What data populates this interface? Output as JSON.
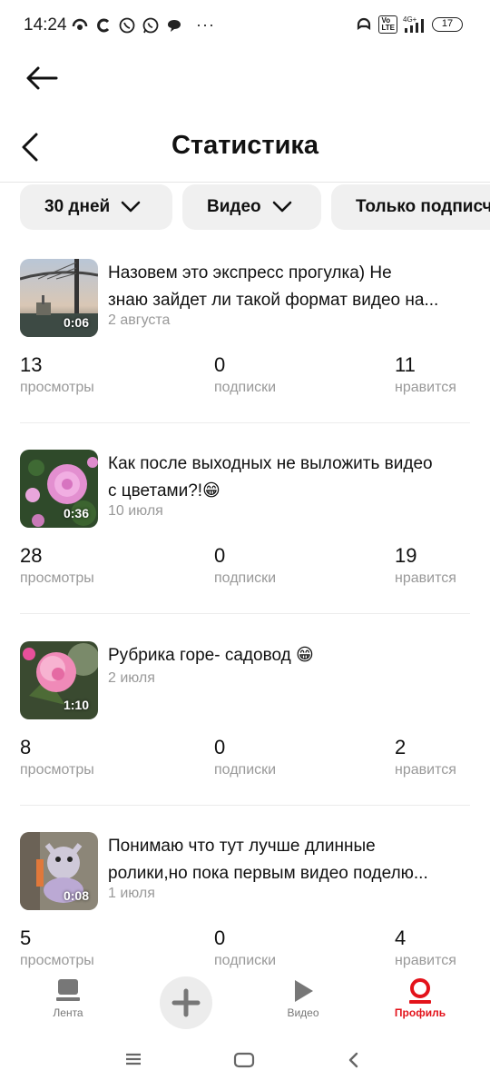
{
  "status_bar": {
    "time": "14:24",
    "dots": "···",
    "network": "4G+",
    "volte": "Vo LTE",
    "battery": "17"
  },
  "header": {
    "title": "Статистика"
  },
  "filters": [
    {
      "label": "30 дней"
    },
    {
      "label": "Видео"
    },
    {
      "label": "Только подписчики"
    }
  ],
  "stat_labels": {
    "views": "просмотры",
    "subs": "подписки",
    "likes": "нравится"
  },
  "videos": [
    {
      "title_line1": "Назовем это экспресс прогулка) Не",
      "title_line2": "знаю зайдет ли такой формат видео на...",
      "date": "2 августа",
      "duration": "0:06",
      "views": "13",
      "subs": "0",
      "likes": "11"
    },
    {
      "title_line1": "Как после выходных не выложить видео",
      "title_line2": "с цветами?!😁",
      "date": "10 июля",
      "duration": "0:36",
      "views": "28",
      "subs": "0",
      "likes": "19"
    },
    {
      "title_line1": "Рубрика горе- садовод 😁",
      "title_line2": "",
      "date": "2 июля",
      "duration": "1:10",
      "views": "8",
      "subs": "0",
      "likes": "2"
    },
    {
      "title_line1": "Понимаю что тут лучше длинные",
      "title_line2": "ролики,но пока первым видео поделю...",
      "date": "1 июля",
      "duration": "0:08",
      "views": "5",
      "subs": "0",
      "likes": "4"
    }
  ],
  "bottom_nav": {
    "feed": "Лента",
    "video": "Видео",
    "profile": "Профиль"
  },
  "colors": {
    "accent": "#e3131b",
    "chip_bg": "#f0f0f0",
    "secondary_text": "#999999"
  }
}
